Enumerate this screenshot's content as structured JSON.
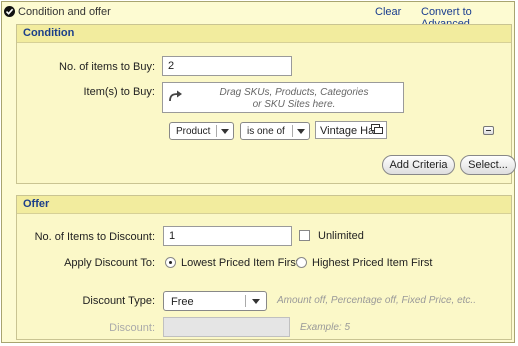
{
  "panel": {
    "title": "Condition and offer",
    "clear_label": "Clear",
    "convert_label": "Convert to Advanced"
  },
  "condition": {
    "header": "Condition",
    "items_to_buy_label": "No. of items to Buy:",
    "items_to_buy_value": "2",
    "items_label": "Item(s) to Buy:",
    "dropzone_line1": "Drag SKUs, Products, Categories",
    "dropzone_line2": "or SKU Sites here.",
    "criteria_type": "Product",
    "criteria_operator": "is one of",
    "criteria_value": "Vintage Hat",
    "add_criteria_label": "Add Criteria",
    "select_label": "Select..."
  },
  "offer": {
    "header": "Offer",
    "items_to_discount_label": "No. of Items to Discount:",
    "items_to_discount_value": "1",
    "unlimited_label": "Unlimited",
    "apply_discount_label": "Apply Discount To:",
    "lowest_label": "Lowest Priced Item First",
    "highest_label": "Highest Priced Item First",
    "discount_type_label": "Discount Type:",
    "discount_type_value": "Free",
    "discount_type_hint": "Amount off, Percentage off, Fixed Price, etc..",
    "discount_label": "Discount:",
    "discount_value": "",
    "discount_hint": "Example: 5"
  },
  "colors": {
    "panel_bg": "#fdfbd2",
    "section_header_bg": "#f2ec9e",
    "header_text": "#1c3f8a",
    "link": "#1a3d8f"
  },
  "icons": {
    "panel_toggle": "check-circle-icon",
    "dropzone": "curved-arrow-icon",
    "tag_popup": "popup-window-icon",
    "remove": "minus-icon"
  }
}
